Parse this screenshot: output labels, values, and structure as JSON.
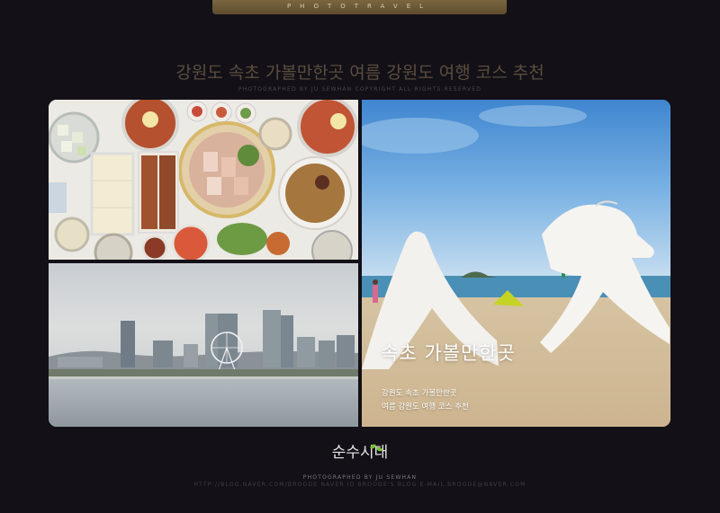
{
  "header": {
    "tab_label": "PHOTOTRAVEL",
    "title": "강원도 속초 가볼만한곳 여름 강원도 여행 코스 추천",
    "copyright": "PHOTOGRAPHED BY JU SEWHAN  COPYRIGHT  ALL RIGHTS RESERVED"
  },
  "photos": {
    "top_left": "food",
    "bottom_left": "city",
    "right": "beach"
  },
  "overlay": {
    "title": "속초 가볼만한곳",
    "line1": "강원도 속초 가볼만한곳",
    "line2": "여름 강원도 여행 코스 추천"
  },
  "footer": {
    "logo_text": "순수시대",
    "credit": "PHOTOGRAPHED BY JU SEWHAN",
    "links": "HTTP://BLOG.NAVER.COM/BROODE  NAVER ID BROODE'S BLOG  E-MAIL.BROODE@NAVER.COM"
  },
  "colors": {
    "background": "#131017",
    "tab": "#6b5934",
    "title": "#5a4d3e"
  }
}
